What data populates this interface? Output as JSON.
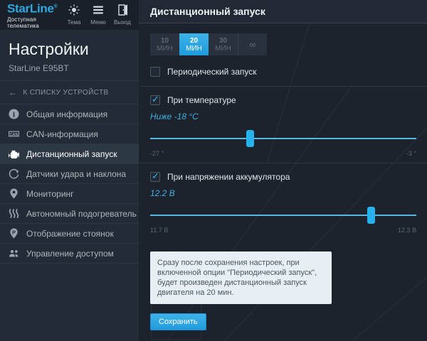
{
  "topbar": {
    "logo": "StarLine",
    "trademark": "®",
    "tagline": "Доступная телематика",
    "actions": [
      {
        "label": "Тема",
        "icon": "theme-sun-icon"
      },
      {
        "label": "Меню",
        "icon": "menu-hamburger-icon"
      },
      {
        "label": "Выход",
        "icon": "exit-door-icon"
      }
    ]
  },
  "sidebar": {
    "title": "Настройки",
    "subtitle": "StarLine E95BT",
    "back_arrow": "←",
    "back_link": "К СПИСКУ УСТРОЙСТВ",
    "items": [
      {
        "label": "Общая информация",
        "icon": "info-icon",
        "active": false
      },
      {
        "label": "CAN-информация",
        "icon": "can-icon",
        "active": false
      },
      {
        "label": "Дистанционный запуск",
        "icon": "engine-icon",
        "active": true
      },
      {
        "label": "Датчики удара и наклона",
        "icon": "shock-sensor-icon",
        "active": false
      },
      {
        "label": "Мониторинг",
        "icon": "map-pin-icon",
        "active": false
      },
      {
        "label": "Автономный подогреватель",
        "icon": "heater-icon",
        "active": false
      },
      {
        "label": "Отображение стоянок",
        "icon": "parking-pin-icon",
        "active": false
      },
      {
        "label": "Управление доступом",
        "icon": "users-icon",
        "active": false
      }
    ]
  },
  "panel": {
    "title": "Дистанционный запуск",
    "duration": {
      "options": [
        {
          "value": "10",
          "unit": "МИН",
          "selected": false
        },
        {
          "value": "20",
          "unit": "МИН",
          "selected": true
        },
        {
          "value": "30",
          "unit": "МИН",
          "selected": false
        },
        {
          "value": "∞",
          "unit": "",
          "selected": false
        }
      ]
    },
    "periodic": {
      "label": "Периодический запуск",
      "checked": false
    },
    "temperature": {
      "label": "При температуре",
      "checked": true,
      "value": "Ниже -18 °C",
      "min": "-27 °",
      "max": "-3 °",
      "percent": 37.5
    },
    "voltage": {
      "label": "При напряжении аккумулятора",
      "checked": true,
      "value": "12.2 В",
      "min": "11.7 В",
      "max": "12.3 В",
      "percent": 83
    },
    "note": "Сразу после сохранения настроек, при включенной опции \"Периодический запуск\", будет произведен дистанционный запуск двигателя на 20 мин.",
    "save_label": "Сохранить"
  },
  "colors": {
    "accent": "#2aa7e2",
    "slider_track": "#57b8e4",
    "slider_handle": "#27b2ee",
    "topbar_bg": "#19202a",
    "sidebar_bg": "#232b37",
    "panel_bg": "#1c232d",
    "note_bg": "#e8eff4"
  }
}
